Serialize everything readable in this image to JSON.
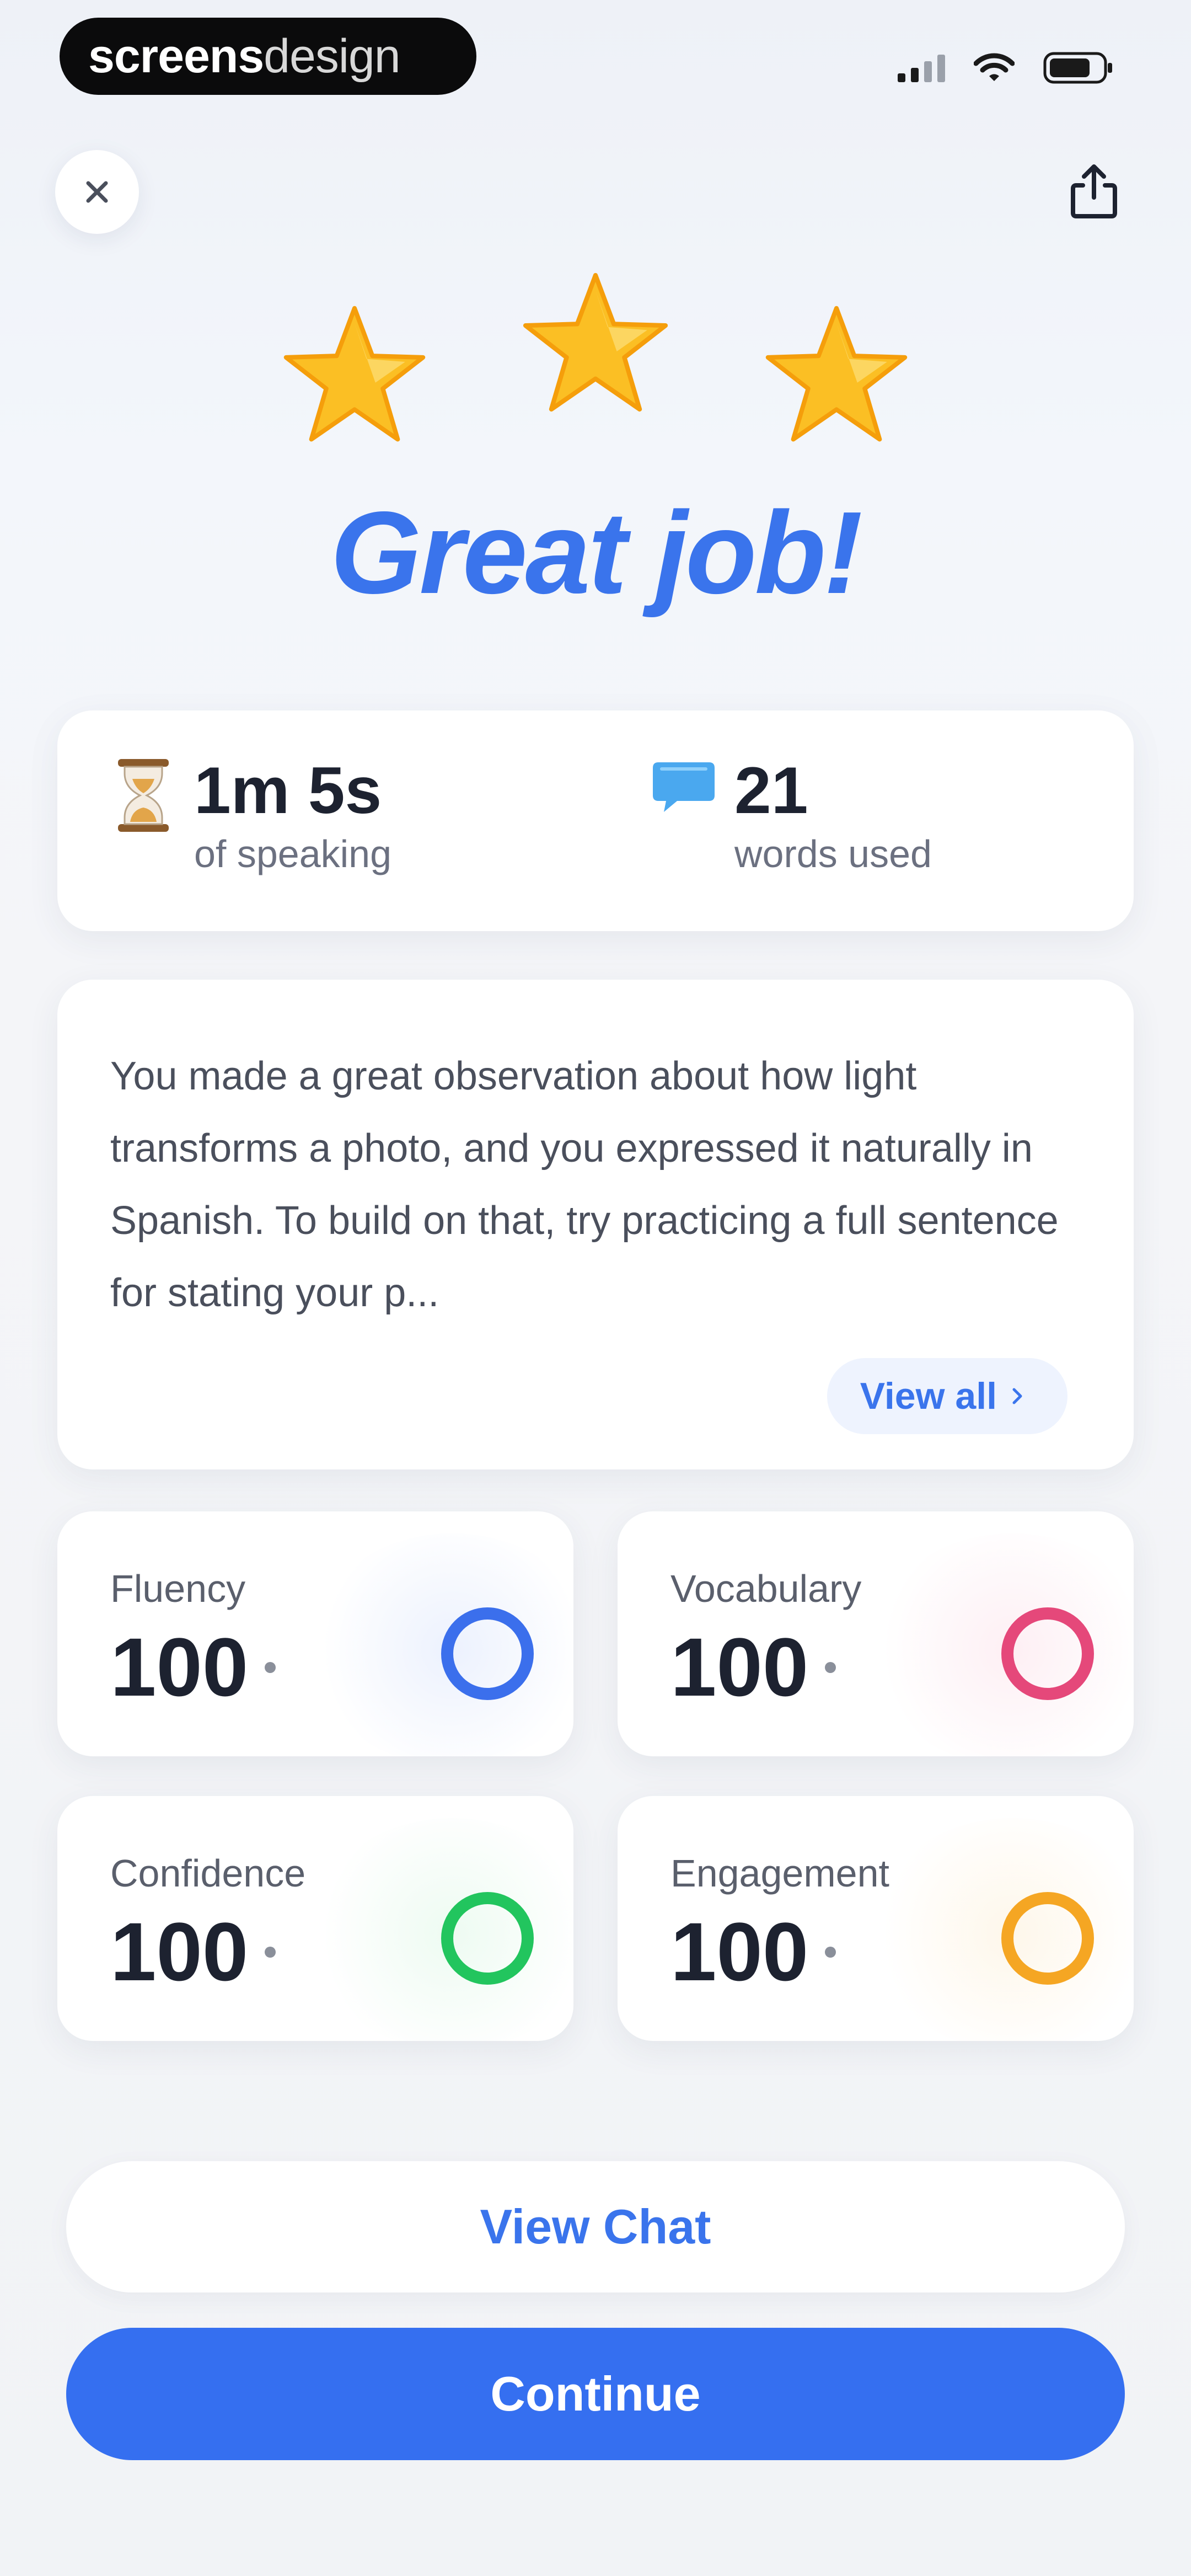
{
  "status_bar": {
    "brand_bold": "screens",
    "brand_light": "design",
    "icons": [
      "cellular-signal-icon",
      "wifi-icon",
      "battery-icon"
    ]
  },
  "header": {
    "close_icon": "close-icon",
    "share_icon": "share-icon"
  },
  "result": {
    "stars_earned": 3,
    "stars_total": 3,
    "headline": "Great job!"
  },
  "stats": {
    "speaking": {
      "icon": "hourglass-icon",
      "value": "1m 5s",
      "label": "of speaking"
    },
    "words": {
      "icon": "speech-bubble-icon",
      "value": "21",
      "label": "words used"
    }
  },
  "feedback": {
    "text": "You made a great observation about how light transforms a photo, and you expressed it naturally in Spanish. To build on that, try practicing a full sentence for stating your p...",
    "view_all_label": "View all"
  },
  "metrics": [
    {
      "label": "Fluency",
      "value": "100",
      "color": "#3b6fec"
    },
    {
      "label": "Vocabulary",
      "value": "100",
      "color": "#e5487a"
    },
    {
      "label": "Confidence",
      "value": "100",
      "color": "#22c55e"
    },
    {
      "label": "Engagement",
      "value": "100",
      "color": "#f5a623"
    }
  ],
  "actions": {
    "view_chat_label": "View Chat",
    "continue_label": "Continue"
  },
  "colors": {
    "accent": "#3a74ec",
    "primary_button": "#356ff0",
    "star": "#fbbf24"
  }
}
